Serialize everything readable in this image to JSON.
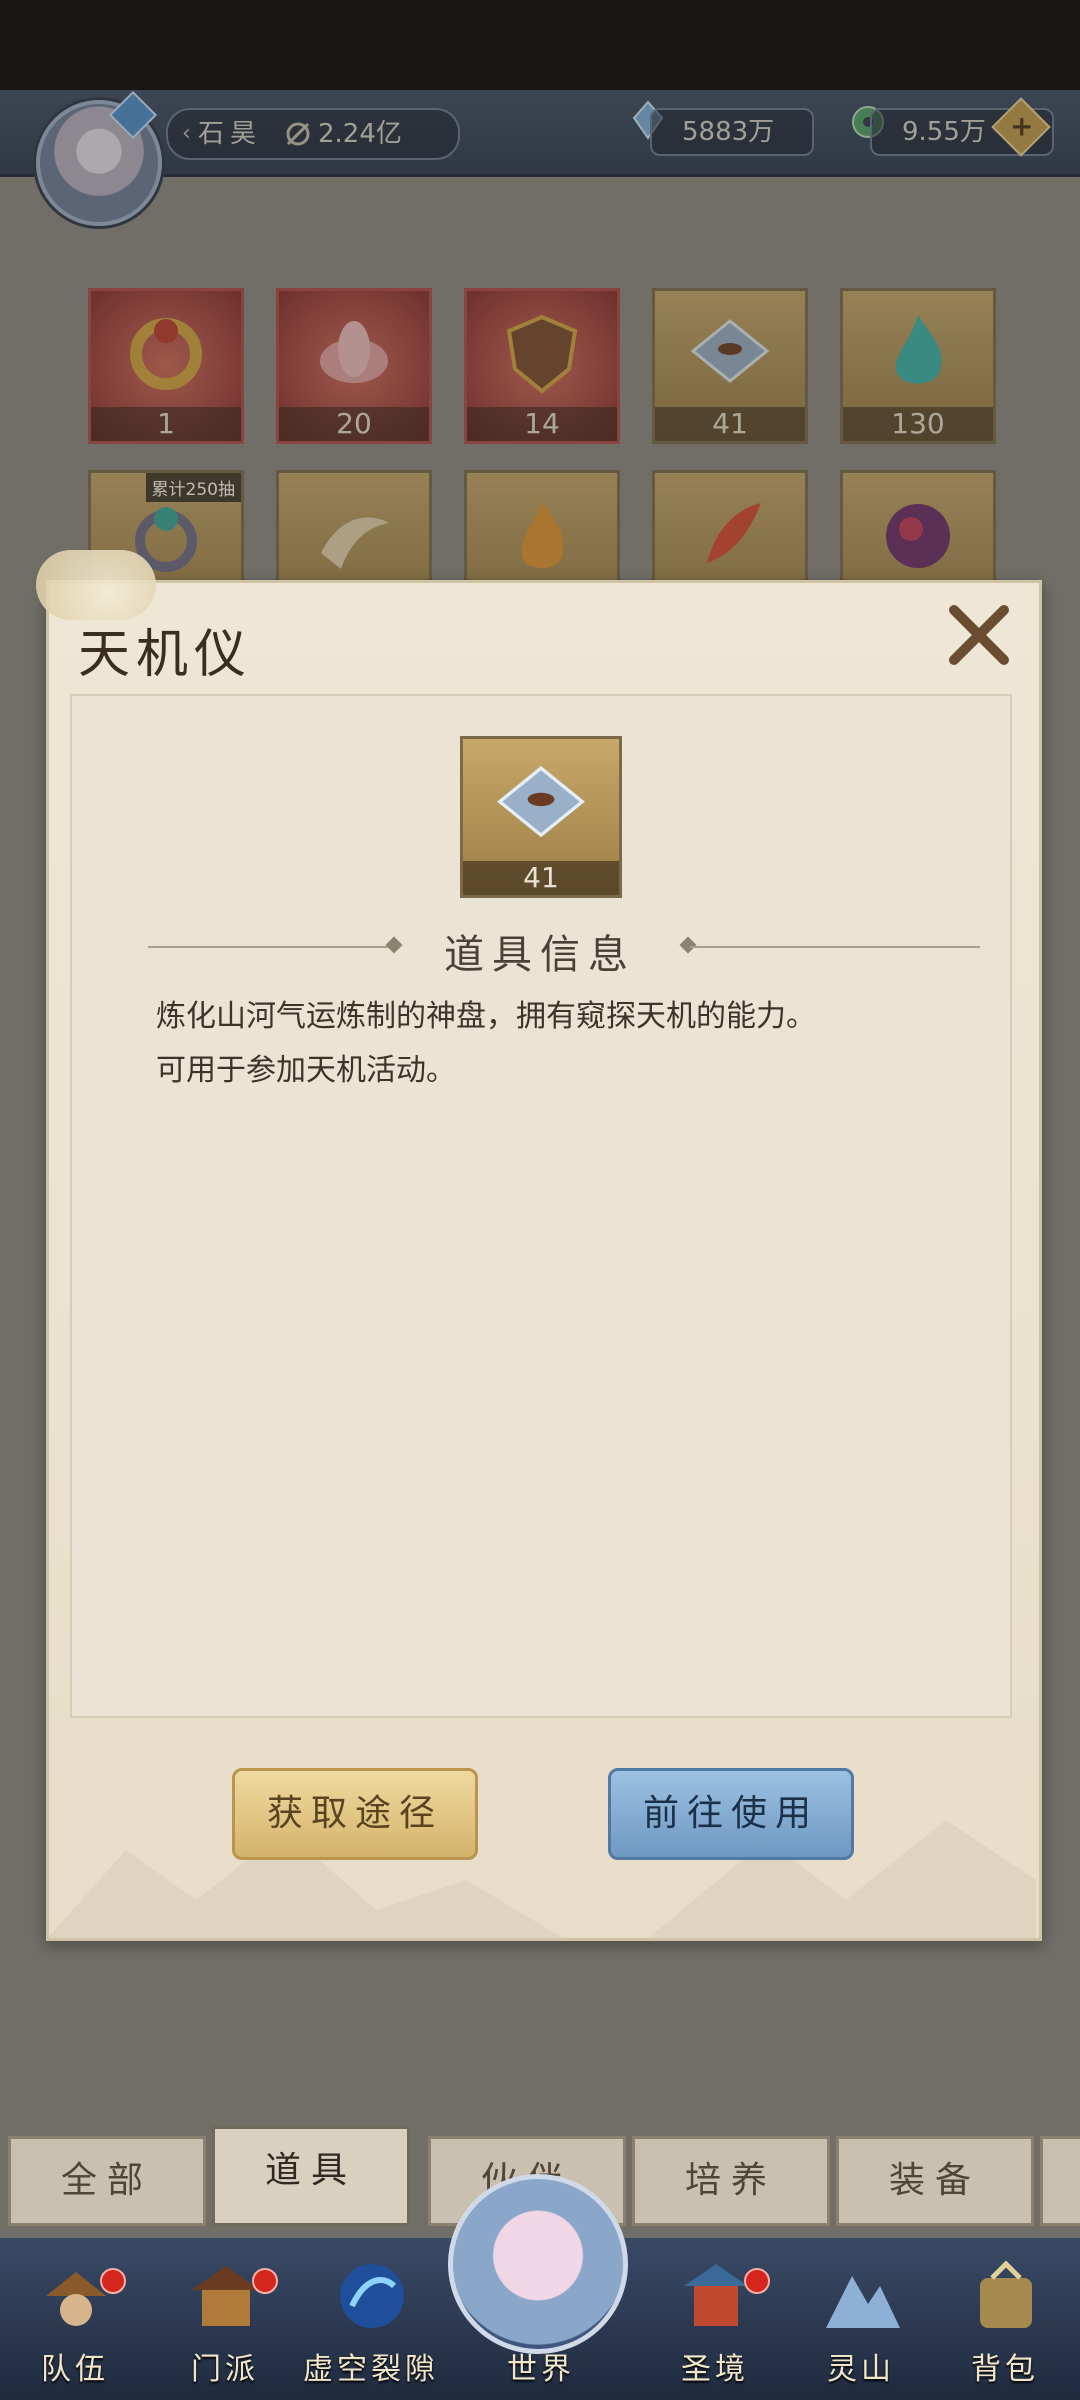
{
  "top_bar": {
    "player_name": "石昊",
    "power": "2.24亿",
    "currency_crystal": "5883万",
    "currency_coin": "9.55万",
    "plus_label": "+"
  },
  "inventory": {
    "row1": [
      {
        "count": "1",
        "icon": "ring-icon",
        "color": "#c0392b"
      },
      {
        "count": "20",
        "icon": "lotus-icon",
        "color": "#d98a8a"
      },
      {
        "count": "14",
        "icon": "shield-icon",
        "color": "#7a4a2a"
      },
      {
        "count": "41",
        "icon": "compass-plate-icon",
        "color": "#9ab0c8"
      },
      {
        "count": "130",
        "icon": "blue-flame-icon",
        "color": "#38b6b0"
      }
    ],
    "row2_tag": "累计250抽"
  },
  "dialog": {
    "title": "天机仪",
    "item_count": "41",
    "section_title": "道具信息",
    "description_line1": "炼化山河气运炼制的神盘，拥有窥探天机的能力。",
    "description_line2": "可用于参加天机活动。",
    "obtain_button": "获取途径",
    "use_button": "前往使用"
  },
  "tabs": [
    "全部",
    "道具",
    "伙伴",
    "培养",
    "装备"
  ],
  "active_tab": "道具",
  "nav": [
    "队伍",
    "门派",
    "虚空裂隙",
    "世界",
    "圣境",
    "灵山",
    "背包"
  ]
}
